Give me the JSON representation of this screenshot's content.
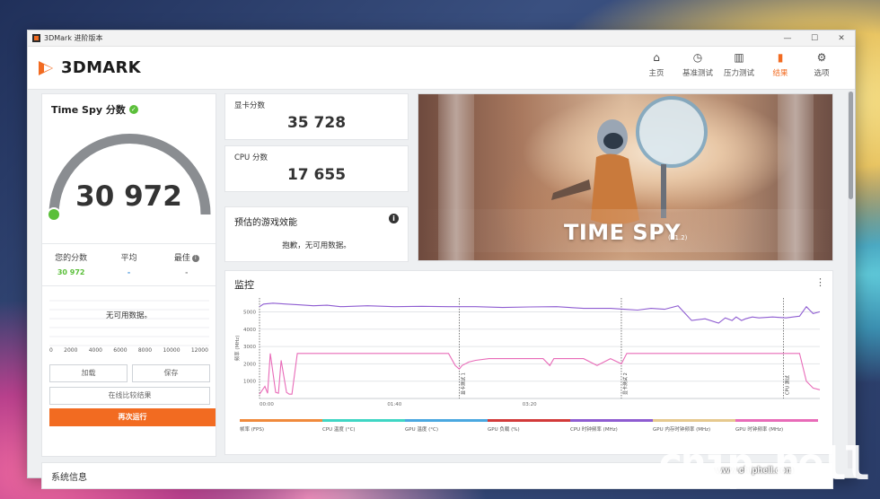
{
  "window": {
    "title": "3DMark 进阶版本",
    "controls": [
      "—",
      "☐",
      "✕"
    ]
  },
  "header": {
    "logo_text": "3DMARK",
    "nav": [
      {
        "label": "主页",
        "icon": "home-icon",
        "glyph": "⌂",
        "active": false
      },
      {
        "label": "基准测试",
        "icon": "gauge-icon",
        "glyph": "◷",
        "active": false
      },
      {
        "label": "压力测试",
        "icon": "bar-chart-icon",
        "glyph": "▥",
        "active": false
      },
      {
        "label": "结果",
        "icon": "results-icon",
        "glyph": "▮",
        "active": true
      },
      {
        "label": "选项",
        "icon": "gear-icon",
        "glyph": "⚙",
        "active": false
      }
    ]
  },
  "score_panel": {
    "title": "Time Spy 分数",
    "score": "30 972",
    "gauge_fraction": 1.0,
    "stats": [
      {
        "label": "您的分数",
        "value": "30 972",
        "style": "green"
      },
      {
        "label": "平均",
        "value": "-",
        "style": "blue"
      },
      {
        "label": "最佳",
        "value": "-",
        "style": "grey"
      }
    ],
    "histogram_message": "无可用数据。",
    "histogram_axis": [
      "0",
      "2000",
      "4000",
      "6000",
      "8000",
      "10000",
      "12000"
    ],
    "buttons": {
      "load": "加载",
      "save": "保存",
      "compare": "在线比较结果",
      "run_again": "再次运行"
    }
  },
  "gpu_score": {
    "label": "显卡分数",
    "value": "35 728"
  },
  "cpu_score": {
    "label": "CPU 分数",
    "value": "17 655"
  },
  "game_perf": {
    "title": "预估的游戏效能",
    "message": "抱歉，无可用数据。"
  },
  "hero": {
    "title": "TIME SPY",
    "version": "(V1.2)"
  },
  "monitor": {
    "title": "监控",
    "menu_glyph": "⋮",
    "y_axis_label": "频率 (MHz)",
    "markers": [
      "显卡测试 1",
      "显卡测试 2",
      "CPU 测试"
    ],
    "legend": [
      {
        "label": "帧率 (FPS)",
        "color": "#f08a3c"
      },
      {
        "label": "CPU 温度 (°C)",
        "color": "#3fd6c4"
      },
      {
        "label": "GPU 温度 (°C)",
        "color": "#4aa8e0"
      },
      {
        "label": "GPU 负载 (%)",
        "color": "#d23a3a"
      },
      {
        "label": "CPU 时钟频率 (MHz)",
        "color": "#8e5cd1"
      },
      {
        "label": "GPU 内存时钟频率 (MHz)",
        "color": "#e6c98e"
      },
      {
        "label": "GPU 时钟频率 (MHz)",
        "color": "#e86bb8"
      }
    ]
  },
  "chart_data": {
    "type": "line",
    "x_ticks": [
      "00:00",
      "01:40",
      "03:20"
    ],
    "y_ticks": [
      1000,
      2000,
      3000,
      4000,
      5000
    ],
    "ylim": [
      0,
      5800
    ],
    "ylabel": "频率 (MHz)",
    "x_range_s": [
      0,
      415
    ],
    "series": [
      {
        "name": "CPU 时钟频率 (MHz)",
        "color": "#8e5cd1",
        "x": [
          0,
          3,
          10,
          20,
          30,
          40,
          50,
          60,
          80,
          100,
          120,
          140,
          160,
          180,
          200,
          220,
          240,
          260,
          270,
          280,
          290,
          300,
          310,
          320,
          330,
          340,
          345,
          350,
          353,
          357,
          360,
          365,
          370,
          380,
          390,
          400,
          405,
          410,
          415
        ],
        "y": [
          5300,
          5450,
          5500,
          5450,
          5400,
          5350,
          5380,
          5300,
          5350,
          5300,
          5320,
          5300,
          5300,
          5250,
          5280,
          5300,
          5200,
          5200,
          5150,
          5100,
          5200,
          5150,
          5350,
          4500,
          4600,
          4350,
          4650,
          4500,
          4700,
          4500,
          4600,
          4700,
          4650,
          4700,
          4650,
          4750,
          5300,
          4900,
          5000
        ]
      },
      {
        "name": "GPU 时钟频率 (MHz)",
        "color": "#e86bb8",
        "x": [
          0,
          4,
          6,
          8,
          12,
          14,
          16,
          20,
          22,
          24,
          28,
          30,
          40,
          50,
          60,
          80,
          100,
          120,
          140,
          145,
          148,
          150,
          155,
          160,
          170,
          180,
          200,
          210,
          215,
          218,
          222,
          225,
          230,
          240,
          250,
          260,
          268,
          272,
          280,
          300,
          320,
          340,
          360,
          380,
          390,
          395,
          400,
          405,
          410,
          415
        ],
        "y": [
          250,
          700,
          300,
          2600,
          350,
          300,
          2200,
          350,
          250,
          250,
          2600,
          2600,
          2600,
          2600,
          2600,
          2600,
          2600,
          2600,
          2600,
          1900,
          1700,
          1900,
          2100,
          2200,
          2300,
          2300,
          2300,
          2300,
          1900,
          2300,
          2300,
          2300,
          2300,
          2300,
          1900,
          2300,
          2000,
          2600,
          2600,
          2600,
          2600,
          2600,
          2600,
          2600,
          2600,
          2600,
          2600,
          1000,
          600,
          500
        ]
      }
    ],
    "marker_x_s": [
      148,
      268,
      388
    ],
    "grid": true
  },
  "system_info": {
    "title": "系统信息"
  },
  "watermark": {
    "text": "chip hell",
    "url": "www.chiphell.com"
  }
}
